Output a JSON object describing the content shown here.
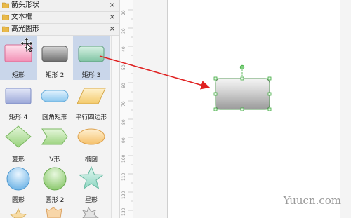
{
  "sidebar": {
    "sections": [
      {
        "title": "箭头形状",
        "close": "×"
      },
      {
        "title": "文本框",
        "close": "×"
      },
      {
        "title": "高光图形",
        "close": "×"
      }
    ],
    "shapes": [
      {
        "label": "矩形"
      },
      {
        "label": "矩形 2"
      },
      {
        "label": "矩形 3"
      },
      {
        "label": "矩形 4"
      },
      {
        "label": "圆角矩形"
      },
      {
        "label": "平行四边形"
      },
      {
        "label": "菱形"
      },
      {
        "label": "V形"
      },
      {
        "label": "椭圆"
      },
      {
        "label": "圆形"
      },
      {
        "label": "圆形 2"
      },
      {
        "label": "星形"
      }
    ],
    "selected_shape": "矩形 3"
  },
  "ruler": {
    "ticks": [
      "20",
      "30",
      "40",
      "50",
      "60",
      "70",
      "80",
      "90",
      "100",
      "110",
      "120",
      "130"
    ]
  },
  "watermark": "Yuucn.com",
  "colors": {
    "arrow": "#e02020",
    "selection_handle": "#3caa3c",
    "selected_cell": "#c9d6ea"
  }
}
